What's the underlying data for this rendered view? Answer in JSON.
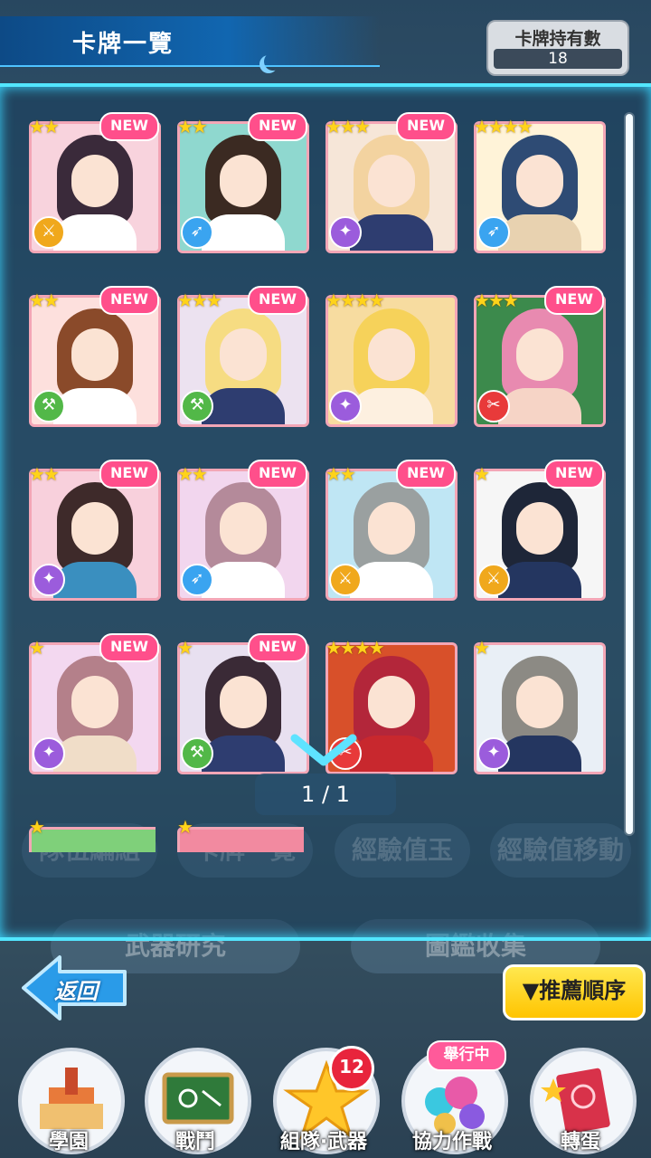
{
  "header": {
    "title": "卡牌一覽",
    "holding_label": "卡牌持有數",
    "holding_count": "18"
  },
  "cards": [
    {
      "stars": "★★",
      "new": "NEW",
      "type": "sword",
      "type_color": "#f0a81c",
      "bg": "#f8d3dd",
      "hair": "#3a2a3a",
      "outfit": "#ffffff"
    },
    {
      "stars": "★★",
      "new": "NEW",
      "type": "lance",
      "type_color": "#3aa4f0",
      "bg": "#8fd8cf",
      "hair": "#3b2a22",
      "outfit": "#ffffff"
    },
    {
      "stars": "★★★",
      "new": "NEW",
      "type": "wand",
      "type_color": "#9b5cdc",
      "bg": "#f6e6d8",
      "hair": "#f3d3a0",
      "outfit": "#2e3d70"
    },
    {
      "stars": "★★★★",
      "new": "",
      "type": "lance",
      "type_color": "#3aa4f0",
      "bg": "#fff3d8",
      "hair": "#2e4b74",
      "outfit": "#e8d2b0"
    },
    {
      "stars": "★★",
      "new": "NEW",
      "type": "hammer",
      "type_color": "#52b848",
      "bg": "#fde0dd",
      "hair": "#8a4a2a",
      "outfit": "#ffffff"
    },
    {
      "stars": "★★★",
      "new": "NEW",
      "type": "hammer",
      "type_color": "#52b848",
      "bg": "#ece2f0",
      "hair": "#f6dc82",
      "outfit": "#2e3d70"
    },
    {
      "stars": "★★★★",
      "new": "",
      "type": "wand",
      "type_color": "#9b5cdc",
      "bg": "#f7dca0",
      "hair": "#f6d25a",
      "outfit": "#fdf0e0"
    },
    {
      "stars": "★★★",
      "new": "NEW",
      "type": "blade",
      "type_color": "#e83a3a",
      "bg": "#3c8a4c",
      "hair": "#e88ab0",
      "outfit": "#f6d4c6"
    },
    {
      "stars": "★★",
      "new": "NEW",
      "type": "wand",
      "type_color": "#9b5cdc",
      "bg": "#f8d0dc",
      "hair": "#3e2a2a",
      "outfit": "#3a8fbf"
    },
    {
      "stars": "★★",
      "new": "NEW",
      "type": "lance",
      "type_color": "#3aa4f0",
      "bg": "#f2d6ee",
      "hair": "#b48a9a",
      "outfit": "#ffffff"
    },
    {
      "stars": "★★",
      "new": "NEW",
      "type": "sword",
      "type_color": "#f0a81c",
      "bg": "#bfe6f4",
      "hair": "#9aa0a0",
      "outfit": "#ffffff"
    },
    {
      "stars": "★",
      "new": "NEW",
      "type": "sword",
      "type_color": "#f0a81c",
      "bg": "#f6f6f6",
      "hair": "#1e2638",
      "outfit": "#243660"
    },
    {
      "stars": "★",
      "new": "NEW",
      "type": "wand",
      "type_color": "#9b5cdc",
      "bg": "#f3d8f0",
      "hair": "#b4808a",
      "outfit": "#f0ddc8"
    },
    {
      "stars": "★",
      "new": "NEW",
      "type": "hammer",
      "type_color": "#52b848",
      "bg": "#e8e0f0",
      "hair": "#3a2a36",
      "outfit": "#2e3d70"
    },
    {
      "stars": "★★★★",
      "new": "",
      "type": "blade",
      "type_color": "#e83a3a",
      "bg": "#d8502a",
      "hair": "#b3263a",
      "outfit": "#c8282e"
    },
    {
      "stars": "★",
      "new": "",
      "type": "wand",
      "type_color": "#9b5cdc",
      "bg": "#e9eff6",
      "hair": "#8c8a84",
      "outfit": "#243660"
    }
  ],
  "partial_cards": [
    {
      "stars": "★"
    },
    {
      "stars": "★"
    }
  ],
  "background_menu": {
    "team": "隊伍編組",
    "cards": "卡牌一覽",
    "exp_jewel": "經驗值玉",
    "exp_transfer": "經驗值移動",
    "weapon_research": "武器研究",
    "collection": "圖鑑收集",
    "badge": "12"
  },
  "pager": {
    "text": "1 / 1"
  },
  "back_button": {
    "label": "返回"
  },
  "sort_button": {
    "label": "▼推薦順序"
  },
  "bottom_nav": [
    {
      "label": "學園"
    },
    {
      "label": "戰鬥"
    },
    {
      "label": "組隊·武器",
      "badge": "12"
    },
    {
      "label": "協力作戰",
      "tag": "舉行中"
    },
    {
      "label": "轉蛋"
    }
  ]
}
